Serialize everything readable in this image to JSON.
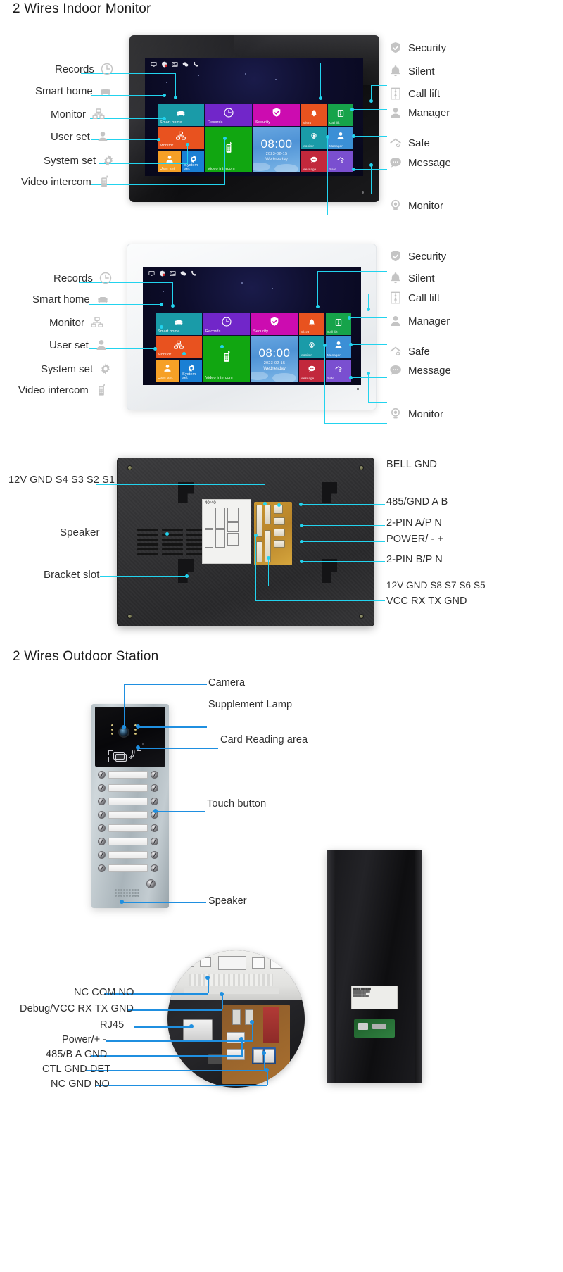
{
  "sections": {
    "indoor_title": "2 Wires Indoor Monitor",
    "outdoor_title": "2 Wires Outdoor Station"
  },
  "screen_ui": {
    "clock": {
      "time": "08:00",
      "date": "2023-02-15",
      "weekday": "Wednesday"
    },
    "tiles": [
      {
        "id": "smart-home",
        "label": "Smart home",
        "icon": "sofa-icon",
        "color": "#1a9ba8"
      },
      {
        "id": "records",
        "label": "Records",
        "icon": "clock-icon",
        "color": "#7126c9"
      },
      {
        "id": "security",
        "label": "Security",
        "icon": "shield-icon",
        "color": "#cc0cb0"
      },
      {
        "id": "monitor",
        "label": "Monitor",
        "icon": "network-icon",
        "color": "#e8521f"
      },
      {
        "id": "video-intercom",
        "label": "Video intercom",
        "icon": "handset-icon",
        "color": "#11a611"
      },
      {
        "id": "user-set",
        "label": "User set",
        "icon": "person-icon",
        "color": "#f6a026"
      },
      {
        "id": "system-set",
        "label": "System set",
        "icon": "gear-icon",
        "color": "#1a7fd4"
      },
      {
        "id": "silent",
        "label": "Silent",
        "icon": "bell-icon",
        "color": "#e8521f"
      },
      {
        "id": "call-lift",
        "label": "Call lift",
        "icon": "lift-icon",
        "color": "#16a34a"
      },
      {
        "id": "monitor-2",
        "label": "Monitor",
        "icon": "camera-icon",
        "color": "#1a9ba8"
      },
      {
        "id": "manager",
        "label": "Manager",
        "icon": "person-icon",
        "color": "#3b8fd6"
      },
      {
        "id": "message",
        "label": "Message",
        "icon": "message-icon",
        "color": "#c2283c"
      },
      {
        "id": "safe",
        "label": "Safe",
        "icon": "house-icon",
        "color": "#7a4fd0"
      }
    ],
    "statusbar_icons": [
      "monitor-icon",
      "shield-icon",
      "picture-icon",
      "chat-icon",
      "phone-icon"
    ]
  },
  "indoor_callouts_left": [
    {
      "label": "Records",
      "icon": "clock-icon"
    },
    {
      "label": "Smart home",
      "icon": "sofa-icon"
    },
    {
      "label": "Monitor",
      "icon": "network-icon"
    },
    {
      "label": "User set",
      "icon": "person-icon"
    },
    {
      "label": "System set",
      "icon": "gear-icon"
    },
    {
      "label": "Video intercom",
      "icon": "handset-icon"
    }
  ],
  "indoor_callouts_right": [
    {
      "label": "Security",
      "icon": "shield-icon"
    },
    {
      "label": "Silent",
      "icon": "bell-icon"
    },
    {
      "label": "Call lift",
      "icon": "lift-icon"
    },
    {
      "label": "Manager",
      "icon": "person-icon"
    },
    {
      "label": "Safe",
      "icon": "house-icon"
    },
    {
      "label": "Message",
      "icon": "message-icon"
    },
    {
      "label": "Monitor",
      "icon": "camera-icon"
    }
  ],
  "back_panel": {
    "left_labels": [
      "12V GND S4 S3 S2 S1",
      "Speaker",
      "Bracket slot"
    ],
    "right_labels": [
      "BELL GND",
      "485/GND A B",
      "2-PIN A/P N",
      "POWER/ - +",
      "2-PIN B/P N",
      "12V GND S8 S7 S6 S5",
      "VCC  RX TX GND"
    ],
    "sticker_title": "40*40"
  },
  "outdoor_station": {
    "labels": [
      "Camera",
      "Supplement Lamp",
      "Card Reading area",
      "Touch button",
      "Speaker"
    ]
  },
  "pcb_labels": [
    "NC COM NO",
    "Debug/VCC RX TX GND",
    "RJ45",
    "Power/+ -",
    "485/B A GND",
    "CTL GND DET",
    "NC GND NO"
  ],
  "colors": {
    "leader_cyan": "#22d3ee",
    "leader_blue": "#1f8fe0",
    "icon_grey": "#c4c4c4"
  }
}
